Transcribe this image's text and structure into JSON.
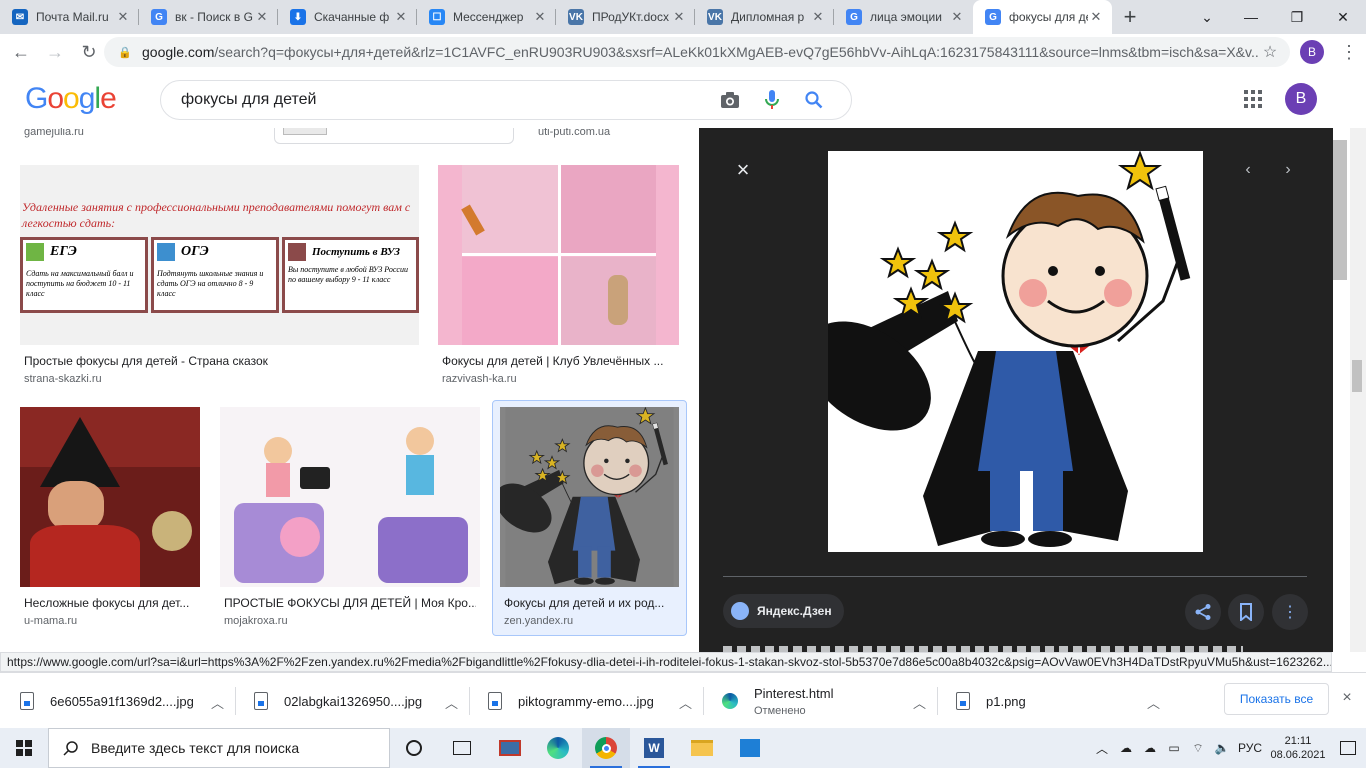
{
  "browser": {
    "tabs": [
      {
        "label": "Почта Mail.ru",
        "icon": "mail-icon",
        "color": "#1565c0",
        "glyph": "✉"
      },
      {
        "label": "вк - Поиск в G",
        "icon": "google-icon",
        "color": "#4285f4",
        "glyph": "G"
      },
      {
        "label": "Скачанные ф",
        "icon": "download-icon",
        "color": "#1a73e8",
        "glyph": "⬇"
      },
      {
        "label": "Мессенджер",
        "icon": "messenger-icon",
        "color": "#2787f5",
        "glyph": "☐"
      },
      {
        "label": "ПРодУКт.docx",
        "icon": "vk-icon",
        "color": "#4a76a8",
        "glyph": "VK"
      },
      {
        "label": "Дипломная р",
        "icon": "vk-icon",
        "color": "#4a76a8",
        "glyph": "VK"
      },
      {
        "label": "лица эмоции",
        "icon": "google-icon",
        "color": "#4285f4",
        "glyph": "G"
      },
      {
        "label": "фокусы для де",
        "icon": "google-icon",
        "color": "#4285f4",
        "glyph": "G"
      }
    ],
    "active_tab": 7,
    "url_host": "google.com",
    "url_rest": "/search?q=фокусы+для+детей&rlz=1C1AVFC_enRU903RU903&sxsrf=ALeKk01kXMgAEB-evQ7gE56hbVv-AihLqA:1623175843111&source=lnms&tbm=isch&sa=X&v...",
    "profile_letter": "B"
  },
  "google": {
    "logo": "Google",
    "query": "фокусы для детей",
    "profile_letter": "B"
  },
  "results": {
    "top_row": [
      {
        "source": "gamejulia.ru"
      },
      {
        "source": "uti-puti.com.ua"
      }
    ],
    "row1": [
      {
        "title": "Простые фокусы для детей - Страна сказок",
        "source": "strana-skazki.ru",
        "banner_headline": "Удаленные занятия с профессиональными преподавателями помогут вам с легкостью сдать:",
        "boxes": [
          {
            "head": "ЕГЭ",
            "text": "Сдать на максимальный балл и поступить на бюджет 10 - 11 класс"
          },
          {
            "head": "ОГЭ",
            "text": "Подтянуть школьные знания и сдать ОГЭ на отлично 8 - 9 класс"
          },
          {
            "head": "Поступить в ВУЗ",
            "text": "Вы поступите в любой ВУЗ России по вашему выбору 9 - 11 класс"
          }
        ]
      },
      {
        "title": "Фокусы для детей | Клуб Увлечённых ...",
        "source": "razvivash-ka.ru"
      }
    ],
    "row2": [
      {
        "title": "Несложные фокусы для дет...",
        "source": "u-mama.ru"
      },
      {
        "title": "ПРОСТЫЕ ФОКУСЫ ДЛЯ ДЕТЕЙ | Моя Кро...",
        "source": "mojakroxa.ru"
      },
      {
        "title": "Фокусы для детей и их род...",
        "source": "zen.yandex.ru"
      }
    ]
  },
  "preview": {
    "source_label": "Яндекс.Дзен",
    "close": "×",
    "prev": "‹",
    "next": "›"
  },
  "status_url": "https://www.google.com/url?sa=i&url=https%3A%2F%2Fzen.yandex.ru%2Fmedia%2Fbigandlittle%2Ffokusy-dlia-detei-i-ih-roditelei-fokus-1-stakan-skvoz-stol-5b5370e7d86e5c00a8b4032c&psig=AOvVaw0EVh3H4DaTDstRpyuVMu5h&ust=1623262...",
  "downloads": {
    "items": [
      {
        "name": "6e6055a91f1369d2....jpg",
        "sub": ""
      },
      {
        "name": "02labgkai1326950....jpg",
        "sub": ""
      },
      {
        "name": "piktogrammy-emo....jpg",
        "sub": ""
      },
      {
        "name": "Pinterest.html",
        "sub": "Отменено"
      },
      {
        "name": "p1.png",
        "sub": ""
      }
    ],
    "show_all": "Показать все",
    "close": "×"
  },
  "taskbar": {
    "search_placeholder": "Введите здесь текст для поиска",
    "language": "РУС",
    "time": "21:11",
    "date": "08.06.2021"
  }
}
